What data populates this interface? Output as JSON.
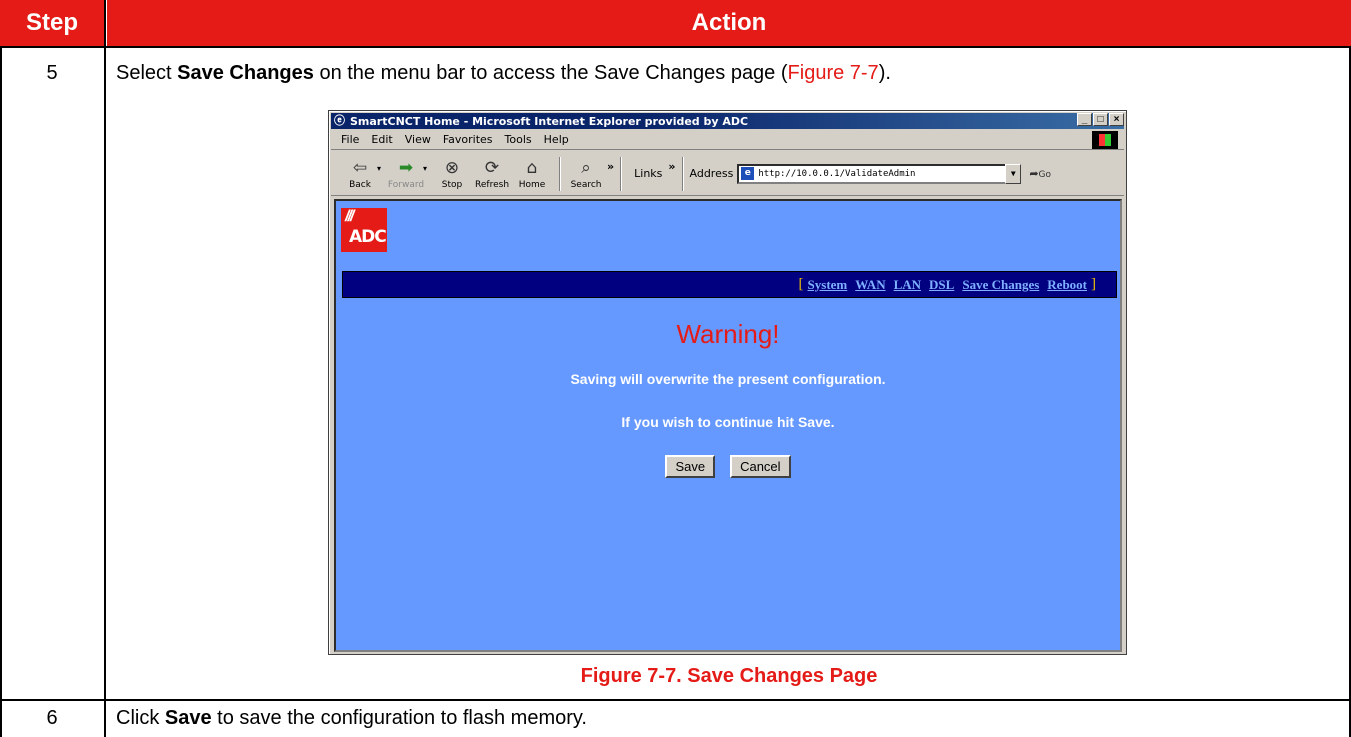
{
  "table": {
    "header_step": "Step",
    "header_action": "Action",
    "rows": [
      {
        "step": "5",
        "pre": "Select ",
        "bold": "Save Changes",
        "post": " on the menu bar to access the Save Changes page (",
        "ref": "Figure 7-7",
        "end": ")."
      },
      {
        "step": "6",
        "pre": "Click ",
        "bold": "Save",
        "post": " to save the configuration to flash memory."
      }
    ]
  },
  "browser": {
    "title": "SmartCNCT Home - Microsoft Internet Explorer provided by ADC",
    "window_buttons": [
      "_",
      "□",
      "×"
    ],
    "menu": [
      "File",
      "Edit",
      "View",
      "Favorites",
      "Tools",
      "Help"
    ],
    "toolbar": {
      "back": "Back",
      "forward": "Forward",
      "stop": "Stop",
      "refresh": "Refresh",
      "home": "Home",
      "search": "Search",
      "links": "Links",
      "address_label": "Address",
      "address_value": "http://10.0.0.1/ValidateAdmin",
      "go": "Go"
    }
  },
  "page": {
    "logo": "ADC",
    "nav": [
      "System",
      "WAN",
      "LAN",
      "DSL",
      "Save Changes",
      "Reboot"
    ],
    "warning": "Warning!",
    "message1": "Saving will overwrite the present configuration.",
    "message2": "If you wish to continue hit Save.",
    "save_label": "Save",
    "cancel_label": "Cancel"
  },
  "caption": "Figure 7-7. Save Changes Page",
  "colors": {
    "header_red": "#e41b17",
    "page_blue": "#6699ff",
    "nav_navy": "#000080"
  }
}
